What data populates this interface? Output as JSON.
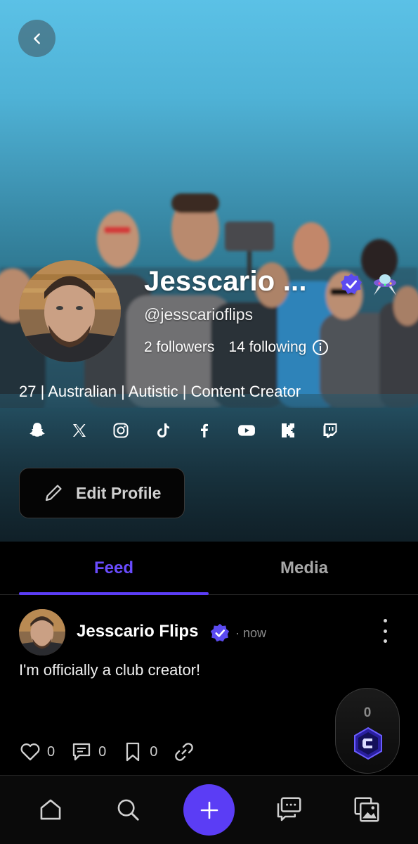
{
  "profile": {
    "display_name": "Jesscario ...",
    "handle": "@jesscarioflips",
    "followers": "2 followers",
    "following": "14 following",
    "bio": "27 | Australian | Autistic | Content Creator",
    "edit_button": "Edit Profile",
    "socials": [
      "snapchat-icon",
      "x-icon",
      "instagram-icon",
      "tiktok-icon",
      "facebook-icon",
      "youtube-icon",
      "kick-icon",
      "twitch-icon"
    ]
  },
  "tabs": [
    {
      "label": "Feed",
      "active": true
    },
    {
      "label": "Media",
      "active": false
    }
  ],
  "post": {
    "author": "Jesscario Flips",
    "time": "· now",
    "text": "I'm officially a club creator!",
    "likes": "0",
    "comments": "0",
    "bookmarks": "0"
  },
  "coin_fab": {
    "count": "0"
  },
  "colors": {
    "accent": "#5b3df5",
    "active_tab": "#6a4cff",
    "verified": "#5b4bf0"
  },
  "bottom_nav": [
    "home-icon",
    "search-icon",
    "create-plus-icon",
    "chat-icon",
    "gallery-icon"
  ]
}
